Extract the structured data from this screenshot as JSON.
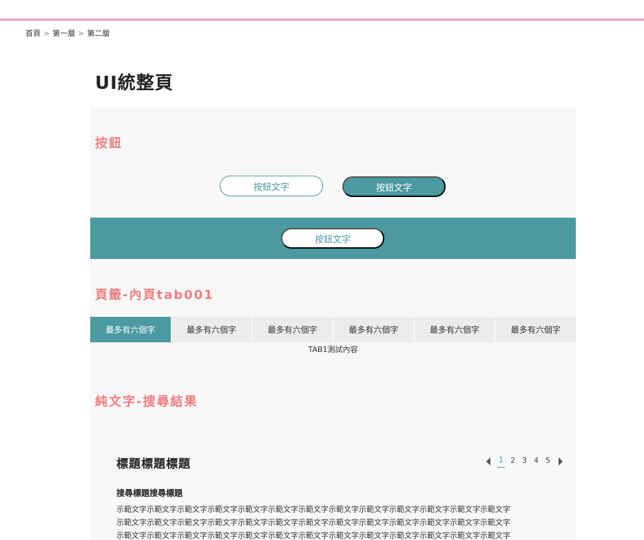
{
  "breadcrumb": {
    "items": [
      "首頁",
      "第一層",
      "第二層"
    ],
    "separator": ">"
  },
  "page": {
    "title": "UI統整頁"
  },
  "sections": {
    "buttons": {
      "heading": "按鈕",
      "outline_label": "按鈕文字",
      "solid_label": "按鈕文字",
      "band_label": "按鈕文字"
    },
    "tabs": {
      "heading": "頁籤-內頁tab001",
      "items": [
        "最多有六個字",
        "最多有六個字",
        "最多有六個字",
        "最多有六個字",
        "最多有六個字",
        "最多有六個字"
      ],
      "active_index": 0,
      "content": "TAB1測試內容"
    },
    "search": {
      "heading": "純文字-搜尋結果",
      "title": "標題標題標題",
      "pager": {
        "pages": [
          "1",
          "2",
          "3",
          "4",
          "5"
        ],
        "current": "1"
      },
      "item_title": "搜尋標題搜尋標題",
      "item_lines": [
        "示範文字示範文字示範文字示範文字示範文字示範文字示範文字示範文字示範文字示範文字示範文字示範文字示範文字",
        "示範文字示範文字示範文字示範文字示範文字示範文字示範文字示範文字示範文字示範文字示範文字示範文字示範文字",
        "示範文字示範文字示範文字示範文字示範文字示範文字示範文字示範文字示範文字示範文字示範文字示範文字示範文字"
      ]
    }
  },
  "colors": {
    "accent": "#4a9aa0",
    "heading": "#ee7f7f",
    "top_line": "#f19ec2",
    "panel": "#f8f8f8"
  }
}
